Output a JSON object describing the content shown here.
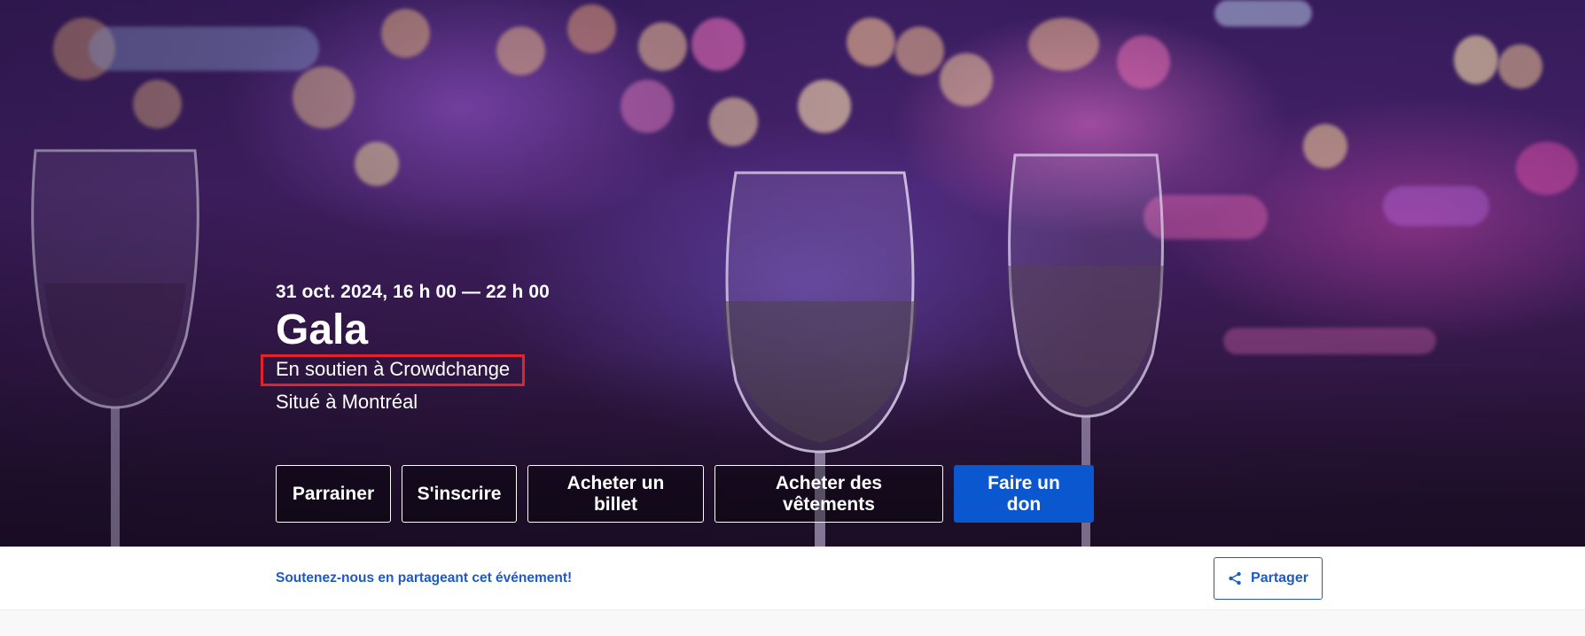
{
  "event": {
    "date_time": "31 oct. 2024, 16 h 00 — 22 h 00",
    "title": "Gala",
    "support_text": "En soutien à Crowdchange",
    "location_text": "Situé à Montréal"
  },
  "actions": {
    "sponsor": "Parrainer",
    "register": "S'inscrire",
    "buy_ticket": "Acheter un billet",
    "buy_clothing": "Acheter des vêtements",
    "donate": "Faire un don"
  },
  "share": {
    "prompt": "Soutenez-nous en partageant cet événement!",
    "button_label": "Partager",
    "icon": "share-icon"
  },
  "colors": {
    "primary": "#0b57d0",
    "link": "#1e59c7",
    "highlight_border": "#e3222a"
  }
}
